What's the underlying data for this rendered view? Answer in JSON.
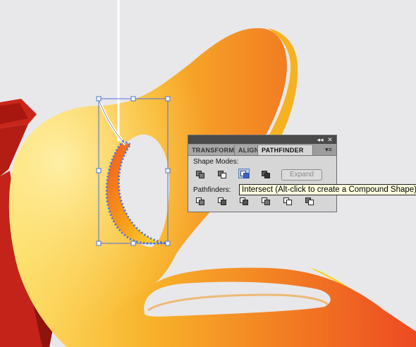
{
  "panel": {
    "tabs": [
      {
        "label": "TRANSFORM"
      },
      {
        "label": "ALIGN"
      },
      {
        "label": "PATHFINDER"
      }
    ],
    "controls": {
      "collapse": "◂◂",
      "close": "✕",
      "menu": "▾≡"
    },
    "shape_modes_label": "Shape Modes:",
    "pathfinders_label": "Pathfinders:",
    "expand_label": "Expand",
    "shape_mode_icons": [
      "unite-icon",
      "minus-front-icon",
      "intersect-icon",
      "exclude-icon"
    ],
    "pathfinder_icons": [
      "divide-icon",
      "trim-icon",
      "merge-icon",
      "crop-icon",
      "outline-icon",
      "minus-back-icon"
    ],
    "active_shape_mode": "intersect-icon"
  },
  "tooltip": {
    "text": "Intersect (Alt-click to create a Compound Shape)"
  },
  "colors": {
    "canvas": "#e8e8ea",
    "shape_light": "#fde06a",
    "shape_mid": "#f6a21c",
    "shape_dark": "#ec4a22",
    "selection": "#4a72d8",
    "extrusion": "#b31d14"
  }
}
